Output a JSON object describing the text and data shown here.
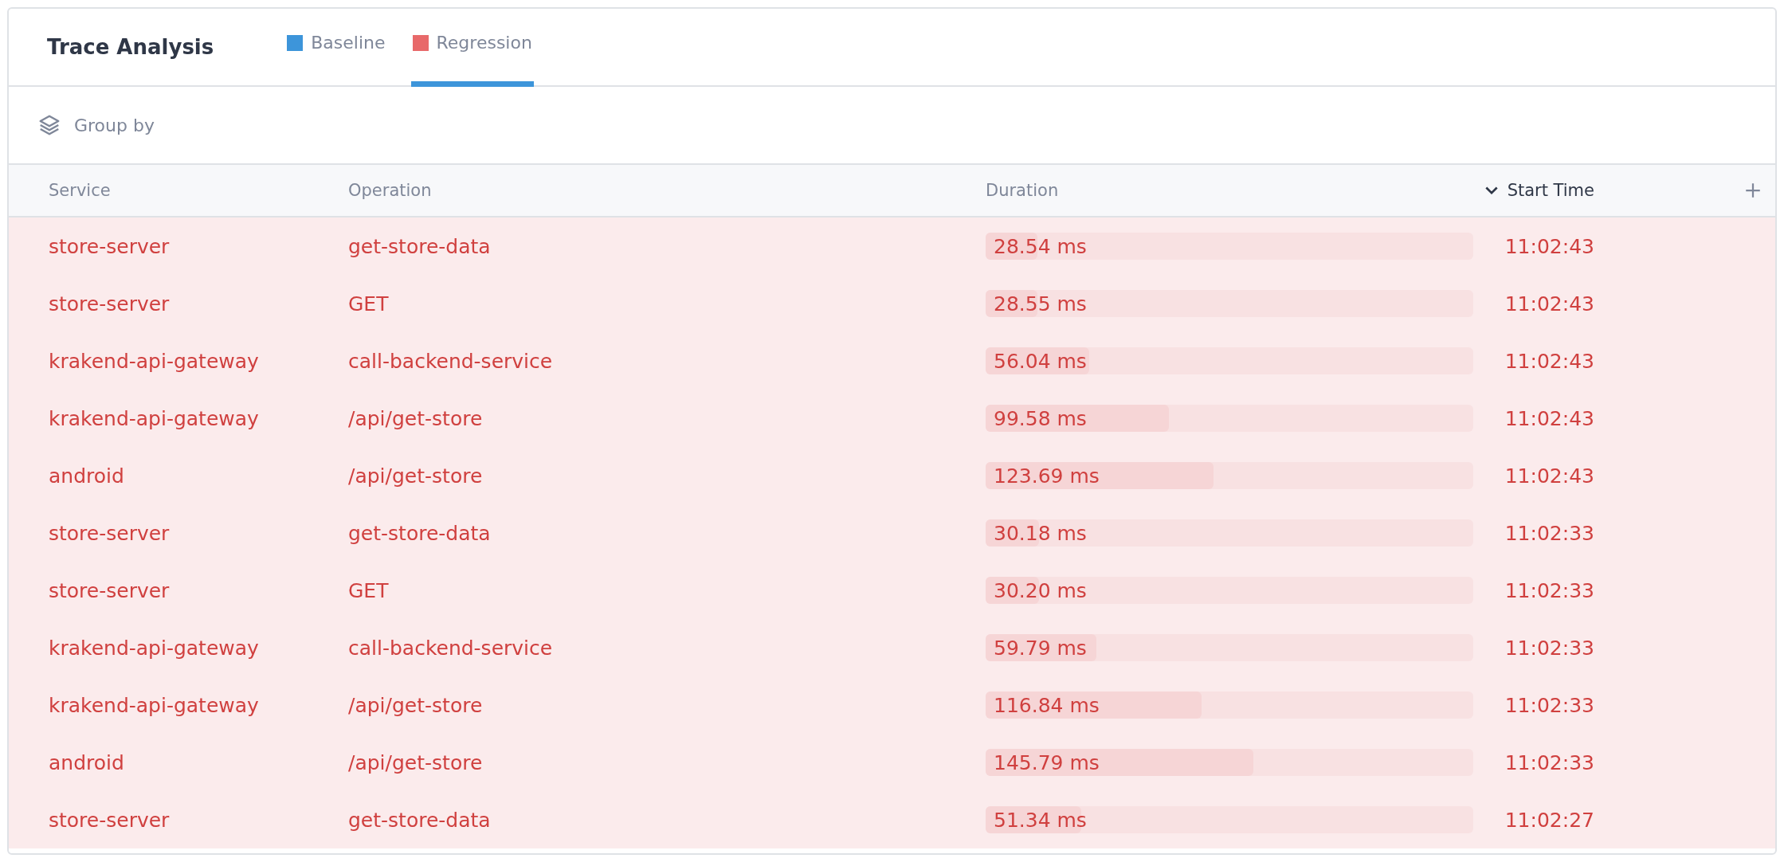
{
  "header": {
    "title": "Trace Analysis",
    "tabs": [
      {
        "label": "Baseline",
        "color": "#3d95da",
        "selected": false
      },
      {
        "label": "Regression",
        "color": "#e8696a",
        "selected": true
      }
    ]
  },
  "toolbar": {
    "group_by": "Group by"
  },
  "table": {
    "columns": [
      {
        "label": "Service",
        "sorted": false
      },
      {
        "label": "Operation",
        "sorted": false
      },
      {
        "label": "Duration",
        "sorted": false
      },
      {
        "label": "Start Time",
        "sorted": true
      }
    ],
    "rows": [
      {
        "service": "store-server",
        "operation": "get-store-data",
        "duration": "28.54 ms",
        "level": 0.107,
        "start_time": "11:02:43"
      },
      {
        "service": "store-server",
        "operation": "GET",
        "duration": "28.55 ms",
        "level": 0.107,
        "start_time": "11:02:43"
      },
      {
        "service": "krakend-api-gateway",
        "operation": "call-backend-service",
        "duration": "56.04 ms",
        "level": 0.213,
        "start_time": "11:02:43"
      },
      {
        "service": "krakend-api-gateway",
        "operation": "/api/get-store",
        "duration": "99.58 ms",
        "level": 0.376,
        "start_time": "11:02:43"
      },
      {
        "service": "android",
        "operation": "/api/get-store",
        "duration": "123.69 ms",
        "level": 0.467,
        "start_time": "11:02:43"
      },
      {
        "service": "store-server",
        "operation": "get-store-data",
        "duration": "30.18 ms",
        "level": 0.11,
        "start_time": "11:02:33"
      },
      {
        "service": "store-server",
        "operation": "GET",
        "duration": "30.20 ms",
        "level": 0.11,
        "start_time": "11:02:33"
      },
      {
        "service": "krakend-api-gateway",
        "operation": "call-backend-service",
        "duration": "59.79 ms",
        "level": 0.227,
        "start_time": "11:02:33"
      },
      {
        "service": "krakend-api-gateway",
        "operation": "/api/get-store",
        "duration": "116.84 ms",
        "level": 0.442,
        "start_time": "11:02:33"
      },
      {
        "service": "android",
        "operation": "/api/get-store",
        "duration": "145.79 ms",
        "level": 0.549,
        "start_time": "11:02:33"
      },
      {
        "service": "store-server",
        "operation": "get-store-data",
        "duration": "51.34 ms",
        "level": 0.196,
        "start_time": "11:02:27"
      }
    ]
  }
}
